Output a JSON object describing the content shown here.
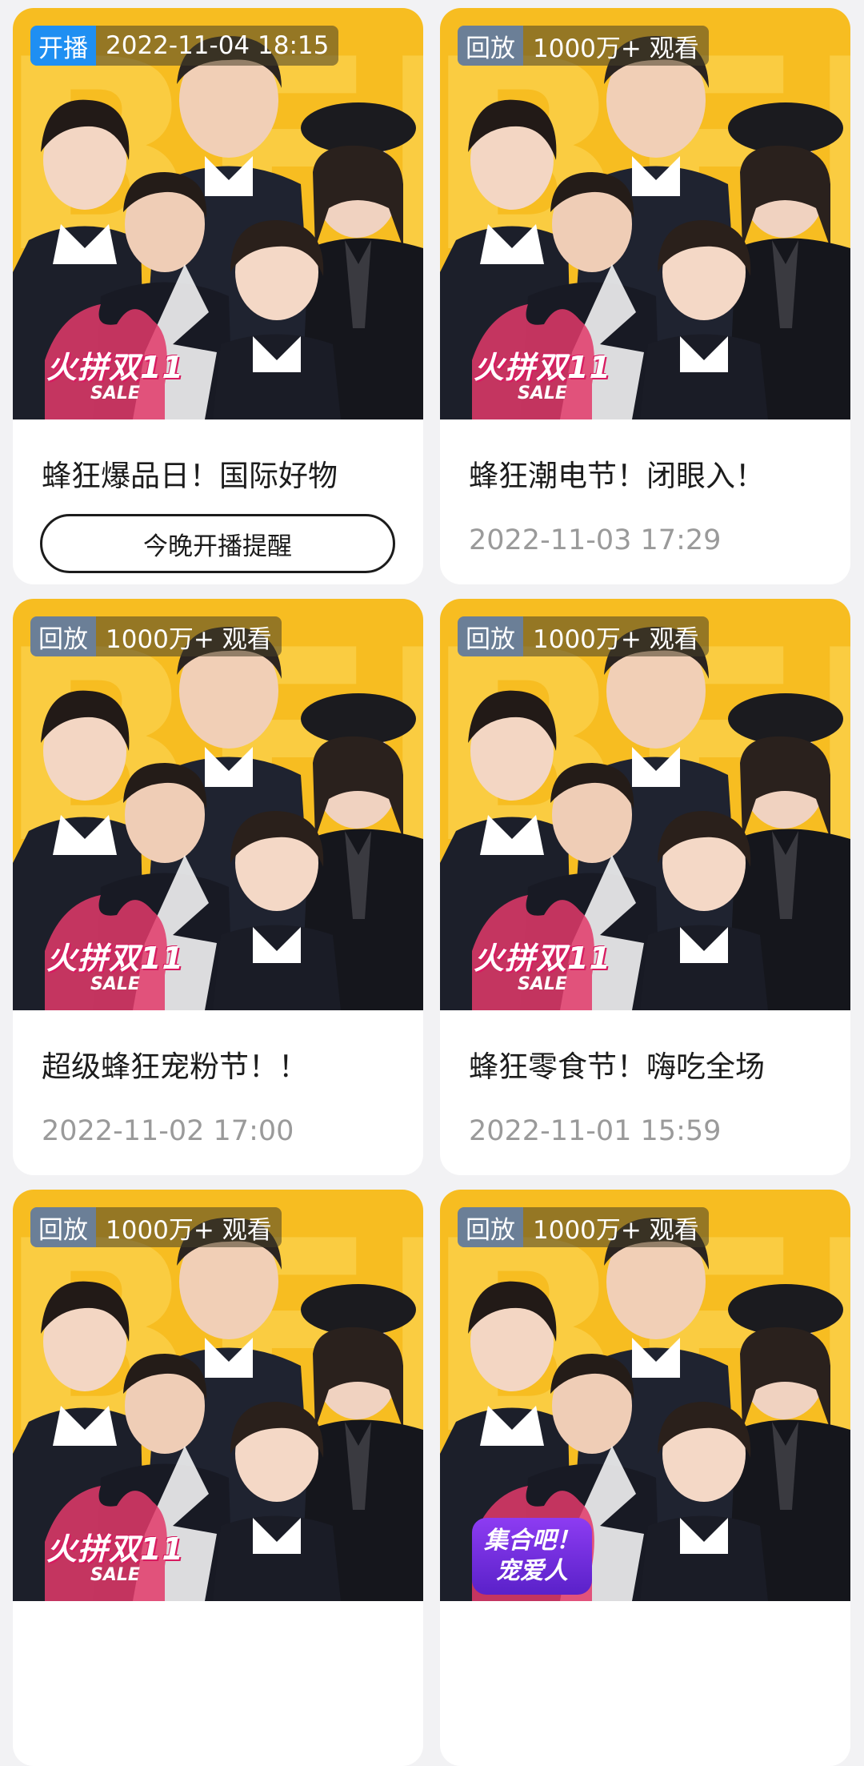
{
  "cards": [
    {
      "status": "开播",
      "info": "2022-11-04 18:15",
      "promo_main": "火拼双11",
      "promo_sub": "SALE",
      "title": "蜂狂爆品日！国际好物",
      "button": "今晚开播提醒"
    },
    {
      "status": "回放",
      "info": "1000万+ 观看",
      "promo_main": "火拼双11",
      "promo_sub": "SALE",
      "title": "蜂狂潮电节！闭眼入！",
      "time": "2022-11-03 17:29"
    },
    {
      "status": "回放",
      "info": "1000万+ 观看",
      "promo_main": "火拼双11",
      "promo_sub": "SALE",
      "title": "超级蜂狂宠粉节！！",
      "time": "2022-11-02 17:00"
    },
    {
      "status": "回放",
      "info": "1000万+ 观看",
      "promo_main": "火拼双11",
      "promo_sub": "SALE",
      "title": "蜂狂零食节！嗨吃全场",
      "time": "2022-11-01 15:59"
    },
    {
      "status": "回放",
      "info": "1000万+ 观看",
      "promo_main": "火拼双11",
      "promo_sub": "SALE"
    },
    {
      "status": "回放",
      "info": "1000万+ 观看",
      "promo_line1": "集合吧！",
      "promo_line2": "宠爱人"
    }
  ],
  "colors": {
    "live_badge": "#1f8ff2",
    "replay_badge": "#6b7f97",
    "thumbnail_bg": "#f7bd21",
    "page_bg": "#f2f2f4"
  },
  "icons": [
    "people-group-image"
  ]
}
